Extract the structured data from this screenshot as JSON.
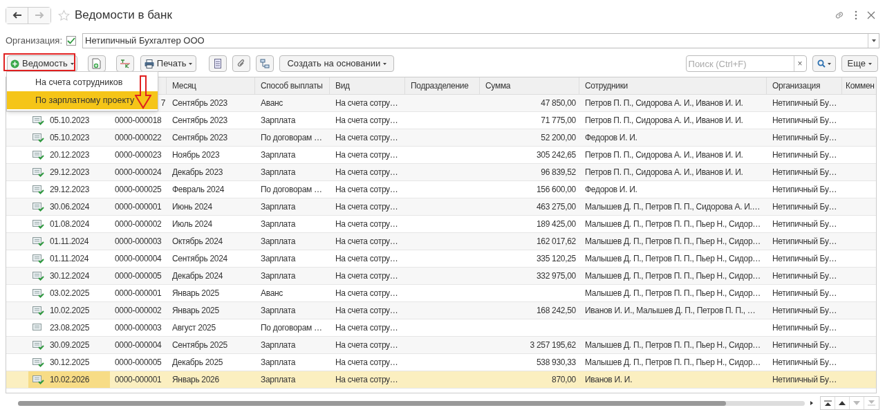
{
  "window": {
    "title": "Ведомости в банк"
  },
  "organization_filter": {
    "label": "Организация:",
    "checked": true,
    "value": "Нетипичный Бухгалтер ООО"
  },
  "toolbar": {
    "create_button": "Ведомость",
    "print_button": "Печать",
    "create_based_button": "Создать на основании",
    "search": {
      "placeholder": "Поиск (Ctrl+F)"
    },
    "clear_button": "×",
    "more_button": "Еще"
  },
  "dropdown_menu": {
    "items": [
      {
        "label": "На счета сотрудников",
        "selected": false
      },
      {
        "label": "По зарплатному проекту",
        "selected": true
      }
    ]
  },
  "table": {
    "columns": [
      "Месяц",
      "Способ выплаты",
      "Вид",
      "Подразделение",
      "Сумма",
      "Сотрудники",
      "Организация",
      "Коммен"
    ],
    "rows": [
      {
        "selected": false,
        "number": "7",
        "month": "Сентябрь 2023",
        "payment_method": "Аванс",
        "type": "На счета сотру…",
        "amount": "47 850,00",
        "employees": "Петров П. П., Сидорова А. И., Иванов И. И.",
        "organization": "Нетипичный Бу…"
      },
      {
        "posted": true,
        "selected": false,
        "date": "05.10.2023",
        "number": "0000-000018",
        "month": "Сентябрь 2023",
        "payment_method": "Зарплата",
        "type": "На счета сотру…",
        "amount": "71 775,00",
        "employees": "Петров П. П., Сидорова А. И., Иванов И. И.",
        "organization": "Нетипичный Бу…"
      },
      {
        "posted": true,
        "selected": false,
        "date": "05.10.2023",
        "number": "0000-000022",
        "month": "Сентябрь 2023",
        "payment_method": "По договорам …",
        "type": "На счета сотру…",
        "amount": "52 200,00",
        "employees": "Федоров И. И.",
        "organization": "Нетипичный Бу…"
      },
      {
        "posted": true,
        "selected": false,
        "date": "20.12.2023",
        "number": "0000-000023",
        "month": "Ноябрь 2023",
        "payment_method": "Зарплата",
        "type": "На счета сотру…",
        "amount": "305 242,65",
        "employees": "Петров П. П., Сидорова А. И., Иванов И. И.",
        "organization": "Нетипичный Бу…"
      },
      {
        "posted": true,
        "selected": false,
        "date": "29.12.2023",
        "number": "0000-000024",
        "month": "Декабрь 2023",
        "payment_method": "Зарплата",
        "type": "На счета сотру…",
        "amount": "96 839,52",
        "employees": "Петров П. П., Сидорова А. И., Иванов И. И.",
        "organization": "Нетипичный Бу…"
      },
      {
        "posted": true,
        "selected": false,
        "date": "29.12.2023",
        "number": "0000-000025",
        "month": "Февраль 2024",
        "payment_method": "По договорам …",
        "type": "На счета сотру…",
        "amount": "156 600,00",
        "employees": "Федоров И. И.",
        "organization": "Нетипичный Бу…"
      },
      {
        "posted": true,
        "selected": false,
        "date": "30.06.2024",
        "number": "0000-000001",
        "month": "Июнь 2024",
        "payment_method": "Зарплата",
        "type": "На счета сотру…",
        "amount": "463 275,00",
        "employees": "Малышев Д. П., Петров П. П., Сидорова А. И.…",
        "organization": "Нетипичный Бу…"
      },
      {
        "posted": true,
        "selected": false,
        "date": "01.08.2024",
        "number": "0000-000002",
        "month": "Июль 2024",
        "payment_method": "Зарплата",
        "type": "На счета сотру…",
        "amount": "189 425,00",
        "employees": "Малышев Д. П., Петров П. П., Пьер Н., Сидор…",
        "organization": "Нетипичный Бу…"
      },
      {
        "posted": true,
        "selected": false,
        "date": "01.11.2024",
        "number": "0000-000003",
        "month": "Октябрь 2024",
        "payment_method": "Зарплата",
        "type": "На счета сотру…",
        "amount": "162 017,62",
        "employees": "Малышев Д. П., Петров П. П., Пьер Н., Сидор…",
        "organization": "Нетипичный Бу…"
      },
      {
        "posted": true,
        "selected": false,
        "date": "01.11.2024",
        "number": "0000-000004",
        "month": "Сентябрь 2024",
        "payment_method": "Зарплата",
        "type": "На счета сотру…",
        "amount": "335 120,25",
        "employees": "Малышев Д. П., Петров П. П., Пьер Н., Сидор…",
        "organization": "Нетипичный Бу…"
      },
      {
        "posted": true,
        "selected": false,
        "date": "30.12.2024",
        "number": "0000-000005",
        "month": "Декабрь 2024",
        "payment_method": "Зарплата",
        "type": "На счета сотру…",
        "amount": "332 975,00",
        "employees": "Малышев Д. П., Петров П. П., Пьер Н., Сидор…",
        "organization": "Нетипичный Бу…"
      },
      {
        "posted": true,
        "selected": false,
        "date": "03.02.2025",
        "number": "0000-000001",
        "month": "Январь 2025",
        "payment_method": "Аванс",
        "type": "На счета сотру…",
        "employees": "Малышев Д. П., Петров П. П., Пьер Н., Сидор…",
        "organization": "Нетипичный Бу…"
      },
      {
        "posted": true,
        "selected": false,
        "date": "10.02.2025",
        "number": "0000-000002",
        "month": "Январь 2025",
        "payment_method": "Зарплата",
        "type": "На счета сотру…",
        "amount": "168 242,50",
        "employees": "Иванов И. И., Малышев Д. П., Петров П. П., …",
        "organization": "Нетипичный Бу…"
      },
      {
        "posted": false,
        "selected": false,
        "date": "23.08.2025",
        "number": "0000-000003",
        "month": "Август 2025",
        "payment_method": "По договорам …",
        "type": "На счета сотру…",
        "organization": "Нетипичный Бу…"
      },
      {
        "posted": true,
        "selected": false,
        "date": "30.09.2025",
        "number": "0000-000004",
        "month": "Сентябрь 2025",
        "payment_method": "Зарплата",
        "type": "На счета сотру…",
        "amount": "3 257 195,62",
        "employees": "Малышев Д. П., Петров П. П., Пьер Н., Сидор…",
        "organization": "Нетипичный Бу…"
      },
      {
        "posted": true,
        "selected": false,
        "date": "30.12.2025",
        "number": "0000-000005",
        "month": "Декабрь 2025",
        "payment_method": "Зарплата",
        "type": "На счета сотру…",
        "amount": "538 930,33",
        "employees": "Малышев Д. П., Петров П. П., Пьер Н., Сидор…",
        "organization": "Нетипичный Бу…"
      },
      {
        "posted": true,
        "selected": true,
        "date": "10.02.2026",
        "number": "0000-000001",
        "month": "Январь 2026",
        "payment_method": "Зарплата",
        "type": "На счета сотру…",
        "amount": "870,00",
        "employees": "Иванов И. И.",
        "organization": "Нетипичный Бу…"
      }
    ]
  }
}
